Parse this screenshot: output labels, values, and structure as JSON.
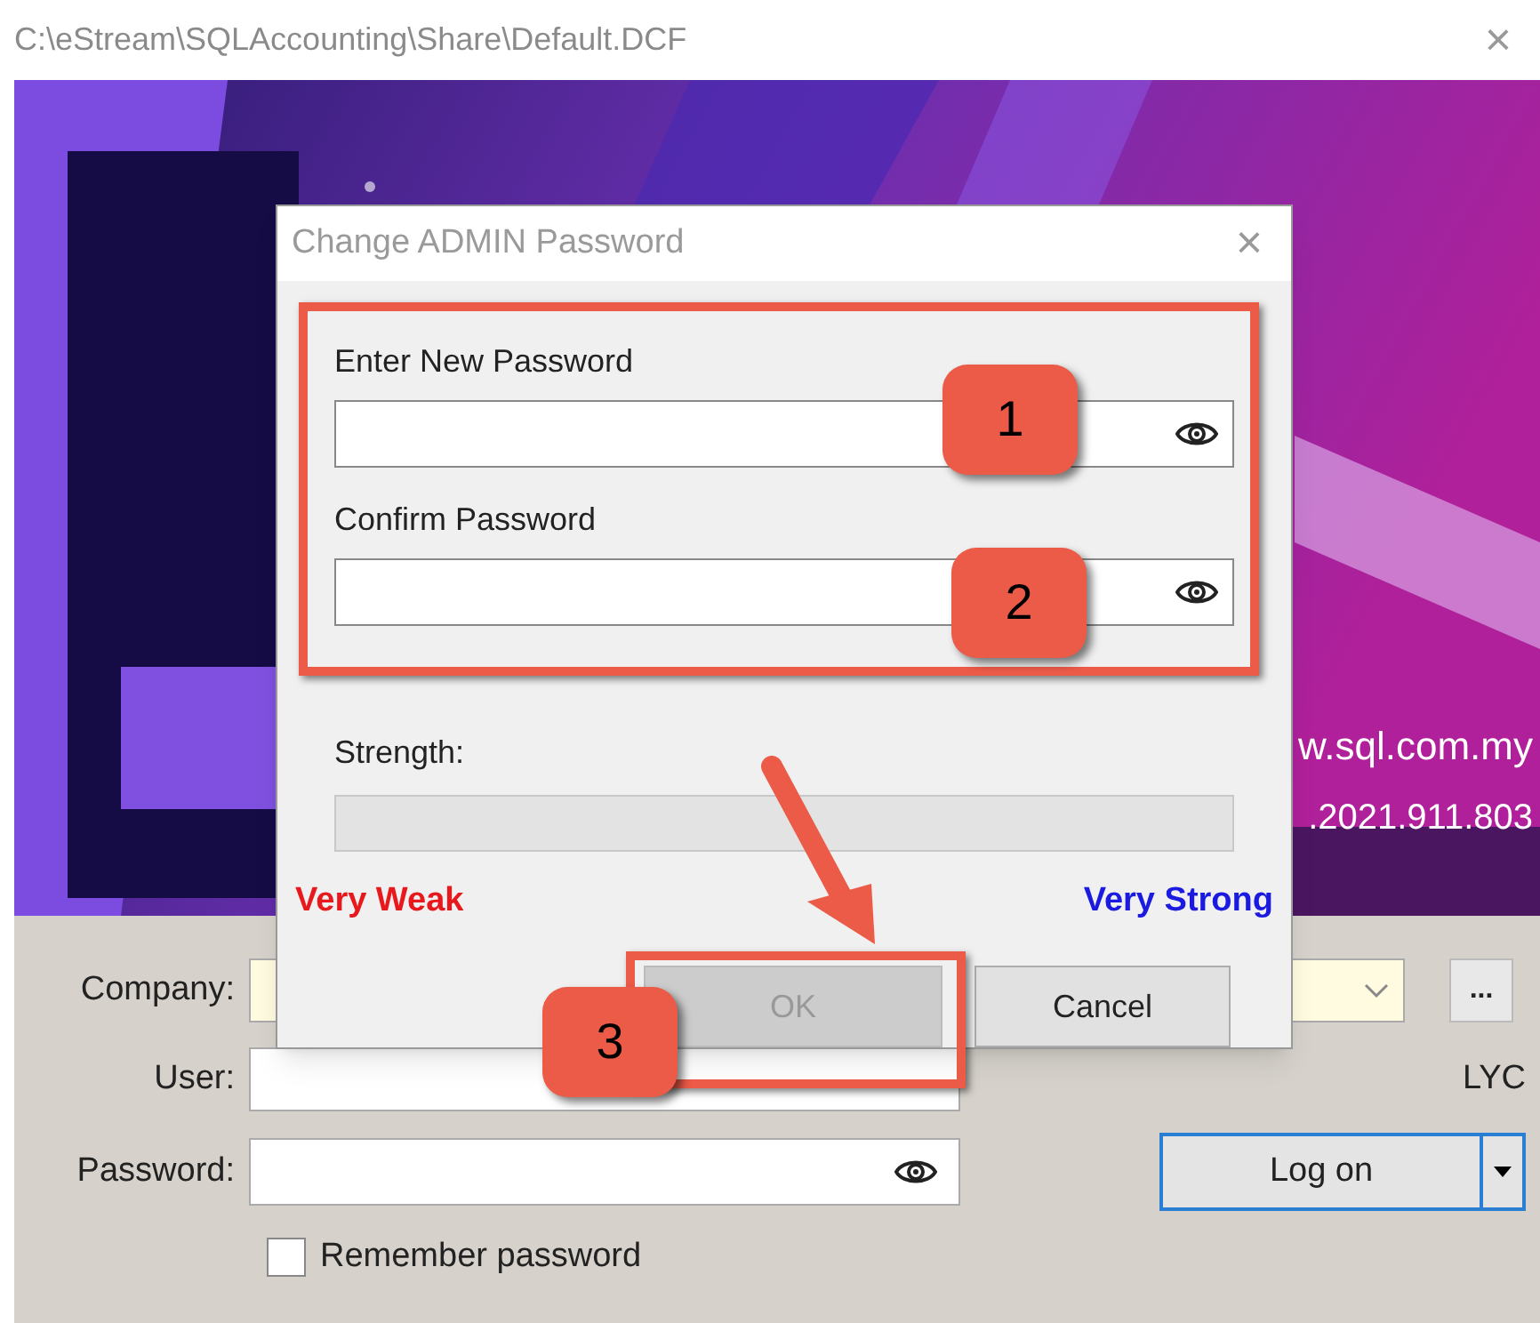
{
  "window": {
    "title": "C:\\eStream\\SQLAccounting\\Share\\Default.DCF",
    "close": "×"
  },
  "banner": {
    "website": "w.sql.com.my",
    "phone": ".2021.911.803"
  },
  "login": {
    "company_label": "Company:",
    "user_label": "User:",
    "user_name": "LYC",
    "password_label": "Password:",
    "more_button": "...",
    "logon_button": "Log on",
    "remember": {
      "label": "Remember password",
      "checked": false
    }
  },
  "dialog": {
    "title": "Change ADMIN Password",
    "close": "×",
    "fields": [
      {
        "label": "Enter New Password"
      },
      {
        "label": "Confirm Password"
      }
    ],
    "strength": {
      "label": "Strength:",
      "level": 0
    },
    "strength_labels": [
      {
        "text": "Very Weak",
        "color": "#e8191c"
      },
      {
        "text": "Very Strong",
        "color": "#1a1ae0"
      }
    ],
    "buttons": [
      {
        "label": "OK",
        "disabled": true
      },
      {
        "label": "Cancel",
        "disabled": false
      }
    ]
  },
  "annotations": [
    {
      "label": "1"
    },
    {
      "label": "2"
    },
    {
      "label": "3"
    }
  ]
}
